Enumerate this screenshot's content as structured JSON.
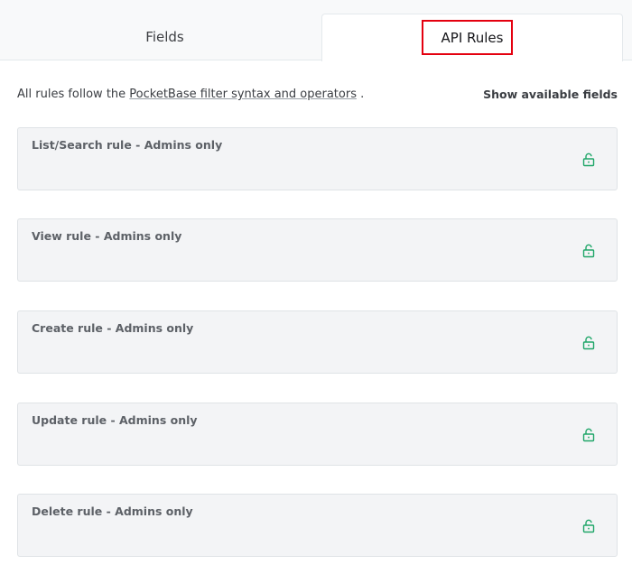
{
  "tabs": {
    "fields_label": "Fields",
    "api_rules_label": "API Rules"
  },
  "intro": {
    "prefix": "All rules follow the ",
    "link_text": "PocketBase filter syntax and operators",
    "suffix": " .",
    "show_fields": "Show available fields"
  },
  "rules": [
    {
      "label": "List/Search rule - Admins only",
      "icon": "unlock-icon"
    },
    {
      "label": "View rule - Admins only",
      "icon": "unlock-icon"
    },
    {
      "label": "Create rule - Admins only",
      "icon": "unlock-icon"
    },
    {
      "label": "Update rule - Admins only",
      "icon": "unlock-icon"
    },
    {
      "label": "Delete rule - Admins only",
      "icon": "unlock-icon"
    }
  ],
  "colors": {
    "accent_green": "#20a669",
    "highlight_red": "#e4000f"
  }
}
